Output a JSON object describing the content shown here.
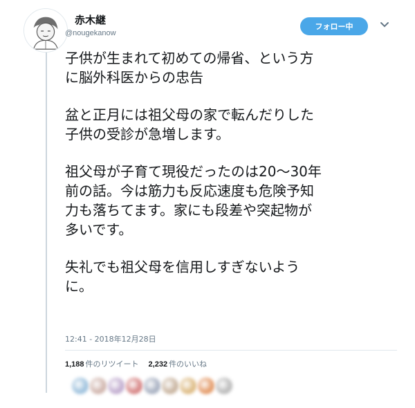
{
  "user": {
    "name": "赤木継",
    "handle": "@nougekanow"
  },
  "header": {
    "follow_label": "フォロー中"
  },
  "tweet": {
    "paragraphs": [
      "子供が生まれて初めての帰省、という方\nに脳外科医からの忠告",
      "盆と正月には祖父母の家で転んだりした\n子供の受診が急増します。",
      "祖父母が子育て現役だったのは20〜30年\n前の話。今は筋力も反応速度も危険予知\n力も落ちてます。家にも段差や突起物が\n多いです。",
      "失礼でも祖父母を信用しすぎないよう\nに。"
    ],
    "timestamp": "12:41 - 2018年12月28日"
  },
  "stats": {
    "retweets_count": "1,188",
    "retweets_label": "件のリツイート",
    "likes_count": "2,232",
    "likes_label": "件のいいね"
  },
  "colors": {
    "accent": "#4aa7e8",
    "muted": "#657786",
    "text": "#14171a",
    "liker_avatars": [
      "#8fb8d8",
      "#c9a9a0",
      "#b8a0c8",
      "#d07070",
      "#9aa4b8",
      "#c0a890",
      "#d8b070",
      "#e08a50",
      "#b0b0b0"
    ]
  },
  "icons": {
    "avatar": "avatar-illustration",
    "caret": "chevron-down-icon"
  }
}
